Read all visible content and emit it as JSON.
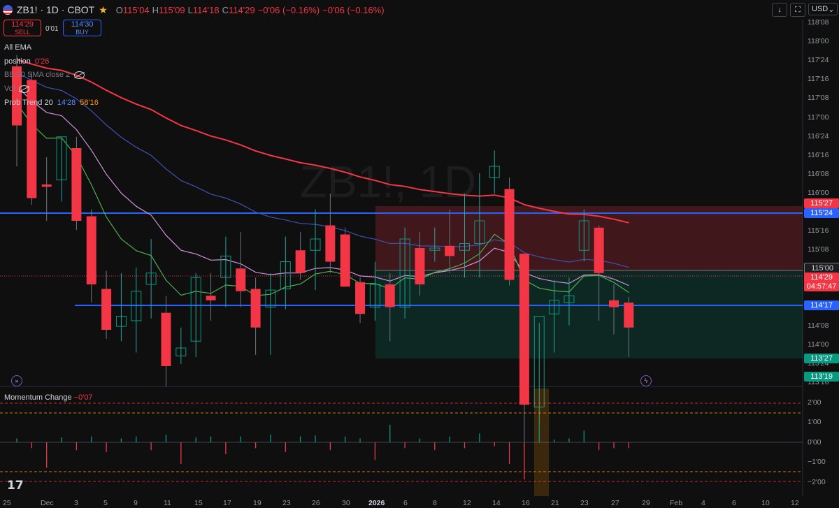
{
  "header": {
    "symbol": "ZB1! · 1D · CBOT",
    "open_label": "O",
    "open": "115'04",
    "high_label": "H",
    "high": "115'09",
    "low_label": "L",
    "low": "114'18",
    "close_label": "C",
    "close": "114'29",
    "change": "−0'06 (−0.16%)",
    "change2": "−0'06 (−0.16%)",
    "currency": "USD"
  },
  "trade": {
    "sell_price": "114'29",
    "sell_label": "SELL",
    "spread": "0'01",
    "buy_price": "114'30",
    "buy_label": "BUY"
  },
  "legend": {
    "ema": "All EMA",
    "position_label": "position",
    "position_value": "0'26",
    "bb": "BB 20 SMA close 2",
    "vol": "Vol",
    "prob_trend": "Prob Trend 20",
    "prob_a": "14'28",
    "prob_b": "58'16"
  },
  "watermark": "ZB1!, 1D",
  "price_tags": [
    {
      "label": "115'27",
      "color": "#f23645"
    },
    {
      "label": "115'24",
      "color": "#2962ff"
    },
    {
      "label": "115'00",
      "color": "#1e1e1e"
    },
    {
      "label": "114'29",
      "color": "#f23645"
    },
    {
      "label": "04:57:47",
      "color": "#f23645"
    },
    {
      "label": "114'17",
      "color": "#2962ff"
    },
    {
      "label": "113'27",
      "color": "#089981"
    },
    {
      "label": "113'19",
      "color": "#089981"
    }
  ],
  "y_axis": [
    "118'08",
    "118'00",
    "117'24",
    "117'16",
    "117'08",
    "117'00",
    "116'24",
    "116'16",
    "116'08",
    "116'00",
    "115'24",
    "115'16",
    "115'08",
    "115'00",
    "114'24",
    "114'16",
    "114'08",
    "114'00",
    "113'24",
    "113'16"
  ],
  "x_axis": [
    "25",
    "Dec",
    "3",
    "5",
    "9",
    "11",
    "15",
    "17",
    "19",
    "23",
    "26",
    "30",
    "2026",
    "6",
    "8",
    "12",
    "14",
    "16",
    "21",
    "23",
    "27",
    "29",
    "Feb",
    "4",
    "6",
    "10",
    "12"
  ],
  "momentum": {
    "label": "Momentum Change",
    "value": "−0'07",
    "y_axis": [
      "2'00",
      "1'00",
      "0'00",
      "−1'00",
      "−2'00"
    ]
  },
  "colors": {
    "up": "#089981",
    "down": "#f23645",
    "ema_red": "#f23645",
    "ema_blue": "#3f51b5",
    "ema_green": "#4caf50",
    "ema_pink": "#ce93d8",
    "level": "#2962ff"
  },
  "chart_data": {
    "type": "candlestick",
    "ylim_price32": [
      113.5,
      118.3
    ],
    "candles": [
      {
        "x": "Nov 28",
        "o": 117.12,
        "h": 117.22,
        "l": 116.24,
        "c": 116.6
      },
      {
        "x": "Dec 1",
        "o": 117.0,
        "h": 117.06,
        "l": 115.9,
        "c": 115.96
      },
      {
        "x": "Dec 2",
        "o": 116.08,
        "h": 116.32,
        "l": 115.76,
        "c": 116.06
      },
      {
        "x": "Dec 3",
        "o": 116.12,
        "h": 116.49,
        "l": 115.93,
        "c": 116.5
      },
      {
        "x": "Dec 4",
        "o": 116.4,
        "h": 116.5,
        "l": 115.68,
        "c": 115.76
      },
      {
        "x": "Dec 5",
        "o": 115.8,
        "h": 115.86,
        "l": 115.04,
        "c": 115.2
      },
      {
        "x": "Dec 8",
        "o": 115.16,
        "h": 115.32,
        "l": 114.72,
        "c": 114.8
      },
      {
        "x": "Dec 9",
        "o": 114.83,
        "h": 115.3,
        "l": 114.7,
        "c": 114.92
      },
      {
        "x": "Dec 10",
        "o": 114.88,
        "h": 115.35,
        "l": 114.6,
        "c": 115.14
      },
      {
        "x": "Dec 11",
        "o": 115.2,
        "h": 115.6,
        "l": 114.9,
        "c": 115.3
      },
      {
        "x": "Dec 12",
        "o": 114.95,
        "h": 115.1,
        "l": 114.3,
        "c": 114.48
      },
      {
        "x": "Dec 15",
        "o": 114.57,
        "h": 114.82,
        "l": 114.5,
        "c": 114.64
      },
      {
        "x": "Dec 16",
        "o": 114.7,
        "h": 115.3,
        "l": 114.56,
        "c": 115.26
      },
      {
        "x": "Dec 17",
        "o": 115.1,
        "h": 115.3,
        "l": 114.88,
        "c": 115.06
      },
      {
        "x": "Dec 18",
        "o": 115.26,
        "h": 115.62,
        "l": 115.0,
        "c": 115.45
      },
      {
        "x": "Dec 19",
        "o": 115.34,
        "h": 115.66,
        "l": 115.0,
        "c": 115.14
      },
      {
        "x": "Dec 22",
        "o": 115.16,
        "h": 115.26,
        "l": 114.58,
        "c": 114.82
      },
      {
        "x": "Dec 23",
        "o": 115.0,
        "h": 115.3,
        "l": 114.58,
        "c": 115.15
      },
      {
        "x": "Dec 24",
        "o": 115.16,
        "h": 115.62,
        "l": 114.98,
        "c": 115.4
      },
      {
        "x": "Dec 26",
        "o": 115.5,
        "h": 115.66,
        "l": 115.24,
        "c": 115.3
      },
      {
        "x": "Dec 29",
        "o": 115.5,
        "h": 115.86,
        "l": 115.15,
        "c": 115.6
      },
      {
        "x": "Dec 30",
        "o": 115.72,
        "h": 116.0,
        "l": 115.3,
        "c": 115.4
      },
      {
        "x": "Dec 31",
        "o": 115.64,
        "h": 115.7,
        "l": 115.18,
        "c": 115.18
      },
      {
        "x": "Jan 2",
        "o": 115.22,
        "h": 115.26,
        "l": 114.86,
        "c": 114.94
      },
      {
        "x": "Jan 5",
        "o": 115.0,
        "h": 115.4,
        "l": 114.88,
        "c": 115.2
      },
      {
        "x": "Jan 6",
        "o": 115.2,
        "h": 115.3,
        "l": 114.7,
        "c": 115.0
      },
      {
        "x": "Jan 7",
        "o": 115.0,
        "h": 115.7,
        "l": 114.9,
        "c": 115.6
      },
      {
        "x": "Jan 8",
        "o": 115.52,
        "h": 115.66,
        "l": 115.1,
        "c": 115.2
      },
      {
        "x": "Jan 9",
        "o": 115.5,
        "h": 115.7,
        "l": 115.4,
        "c": 115.52
      },
      {
        "x": "Jan 12",
        "o": 115.54,
        "h": 115.86,
        "l": 115.3,
        "c": 115.45
      },
      {
        "x": "Jan 13",
        "o": 115.5,
        "h": 116.0,
        "l": 115.26,
        "c": 115.56
      },
      {
        "x": "Jan 14",
        "o": 115.56,
        "h": 116.18,
        "l": 115.26,
        "c": 115.76
      },
      {
        "x": "Jan 15",
        "o": 116.14,
        "h": 116.38,
        "l": 116.0,
        "c": 116.24
      },
      {
        "x": "Jan 16",
        "o": 116.04,
        "h": 116.14,
        "l": 115.19,
        "c": 115.24
      },
      {
        "x": "Jan 20",
        "o": 115.47,
        "h": 115.47,
        "l": 113.69,
        "c": 114.14
      },
      {
        "x": "Jan 21",
        "o": 114.12,
        "h": 114.86,
        "l": 113.96,
        "c": 114.92
      },
      {
        "x": "Jan 22",
        "o": 114.94,
        "h": 115.24,
        "l": 114.6,
        "c": 115.06
      },
      {
        "x": "Jan 23",
        "o": 115.04,
        "h": 115.26,
        "l": 114.84,
        "c": 115.1
      },
      {
        "x": "Jan 26",
        "o": 115.5,
        "h": 115.86,
        "l": 115.4,
        "c": 115.76
      },
      {
        "x": "Jan 27",
        "o": 115.7,
        "h": 115.72,
        "l": 114.88,
        "c": 115.3
      },
      {
        "x": "Jan 28",
        "o": 115.06,
        "h": 115.2,
        "l": 114.76,
        "c": 115.0
      },
      {
        "x": "Jan 29",
        "o": 115.04,
        "h": 115.09,
        "l": 114.56,
        "c": 114.82
      }
    ],
    "momentum_values": [
      0.2,
      -0.3,
      -1.3,
      0.25,
      -0.4,
      0.3,
      -0.5,
      0.2,
      0.3,
      -0.4,
      0.4,
      -1.1,
      0.25,
      0.3,
      -0.6,
      0.3,
      -0.3,
      0.4,
      -0.5,
      0.3,
      0.35,
      -0.4,
      0.3,
      0.2,
      -0.9,
      0.9,
      -0.3,
      0.2,
      -0.4,
      0.3,
      -0.3,
      0.45,
      -0.2,
      -1.1,
      -1.9,
      0.9,
      0.15,
      0.2,
      0.6,
      -0.4,
      -0.3,
      -0.3
    ]
  }
}
